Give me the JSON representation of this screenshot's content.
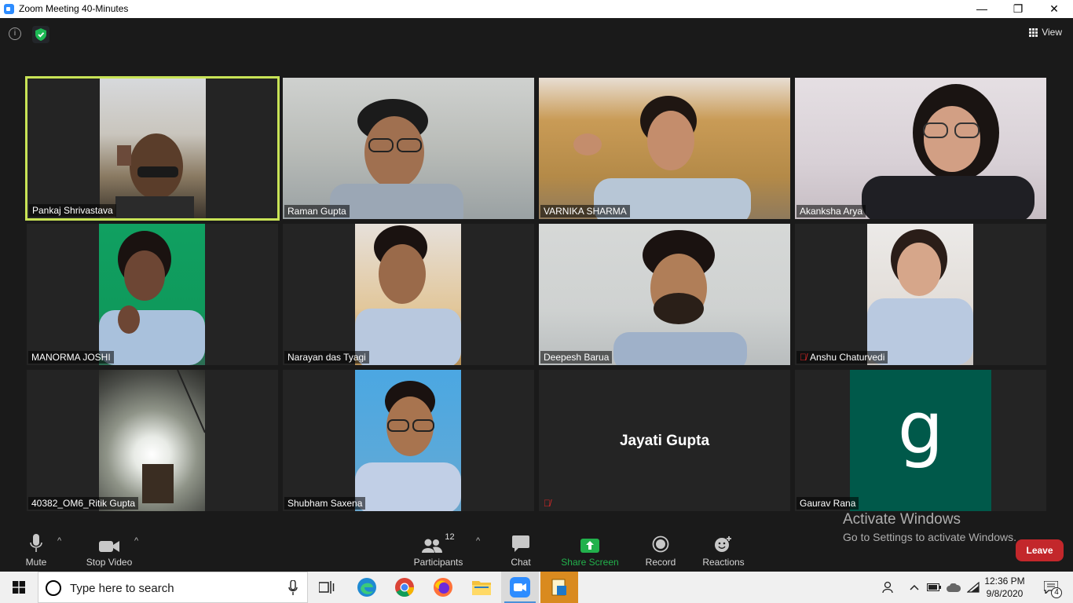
{
  "window": {
    "title": "Zoom Meeting 40-Minutes",
    "minimize": "—",
    "restore": "❐",
    "close": "✕"
  },
  "top": {
    "info_glyph": "i",
    "view_label": "View"
  },
  "participants": [
    {
      "name": "Pankaj Shrivastava",
      "muted": false,
      "active_speaker": true
    },
    {
      "name": "Raman Gupta",
      "muted": false
    },
    {
      "name": "VARNIKA SHARMA",
      "muted": false
    },
    {
      "name": "Akanksha Arya",
      "muted": false
    },
    {
      "name": "MANORMA JOSHI",
      "muted": false
    },
    {
      "name": "Narayan das Tyagi",
      "muted": false
    },
    {
      "name": "Deepesh Barua",
      "muted": false
    },
    {
      "name": "Anshu Chaturvedi",
      "muted": true
    },
    {
      "name": "40382_OM6_Ritik Gupta",
      "muted": false
    },
    {
      "name": "Shubham Saxena",
      "muted": false
    },
    {
      "name": "Jayati Gupta",
      "muted": true,
      "video_off": true
    },
    {
      "name": "Gaurav Rana",
      "muted": false,
      "avatar_letter": "g",
      "avatar_color": "#00594a"
    }
  ],
  "toolbar": {
    "mute": "Mute",
    "stop_video": "Stop Video",
    "participants": "Participants",
    "participants_count": "12",
    "chat": "Chat",
    "share_screen": "Share Screen",
    "record": "Record",
    "reactions": "Reactions",
    "leave": "Leave",
    "caret": "^"
  },
  "watermark": {
    "line1": "Activate Windows",
    "line2": "Go to Settings to activate Windows."
  },
  "taskbar": {
    "search_placeholder": "Type here to search",
    "time": "12:36 PM",
    "date": "9/8/2020",
    "notification_count": "4"
  },
  "colors": {
    "active_border": "#c8e356",
    "share_green": "#22b14c",
    "leave_red": "#c3272b",
    "muted_red": "#e02828"
  }
}
